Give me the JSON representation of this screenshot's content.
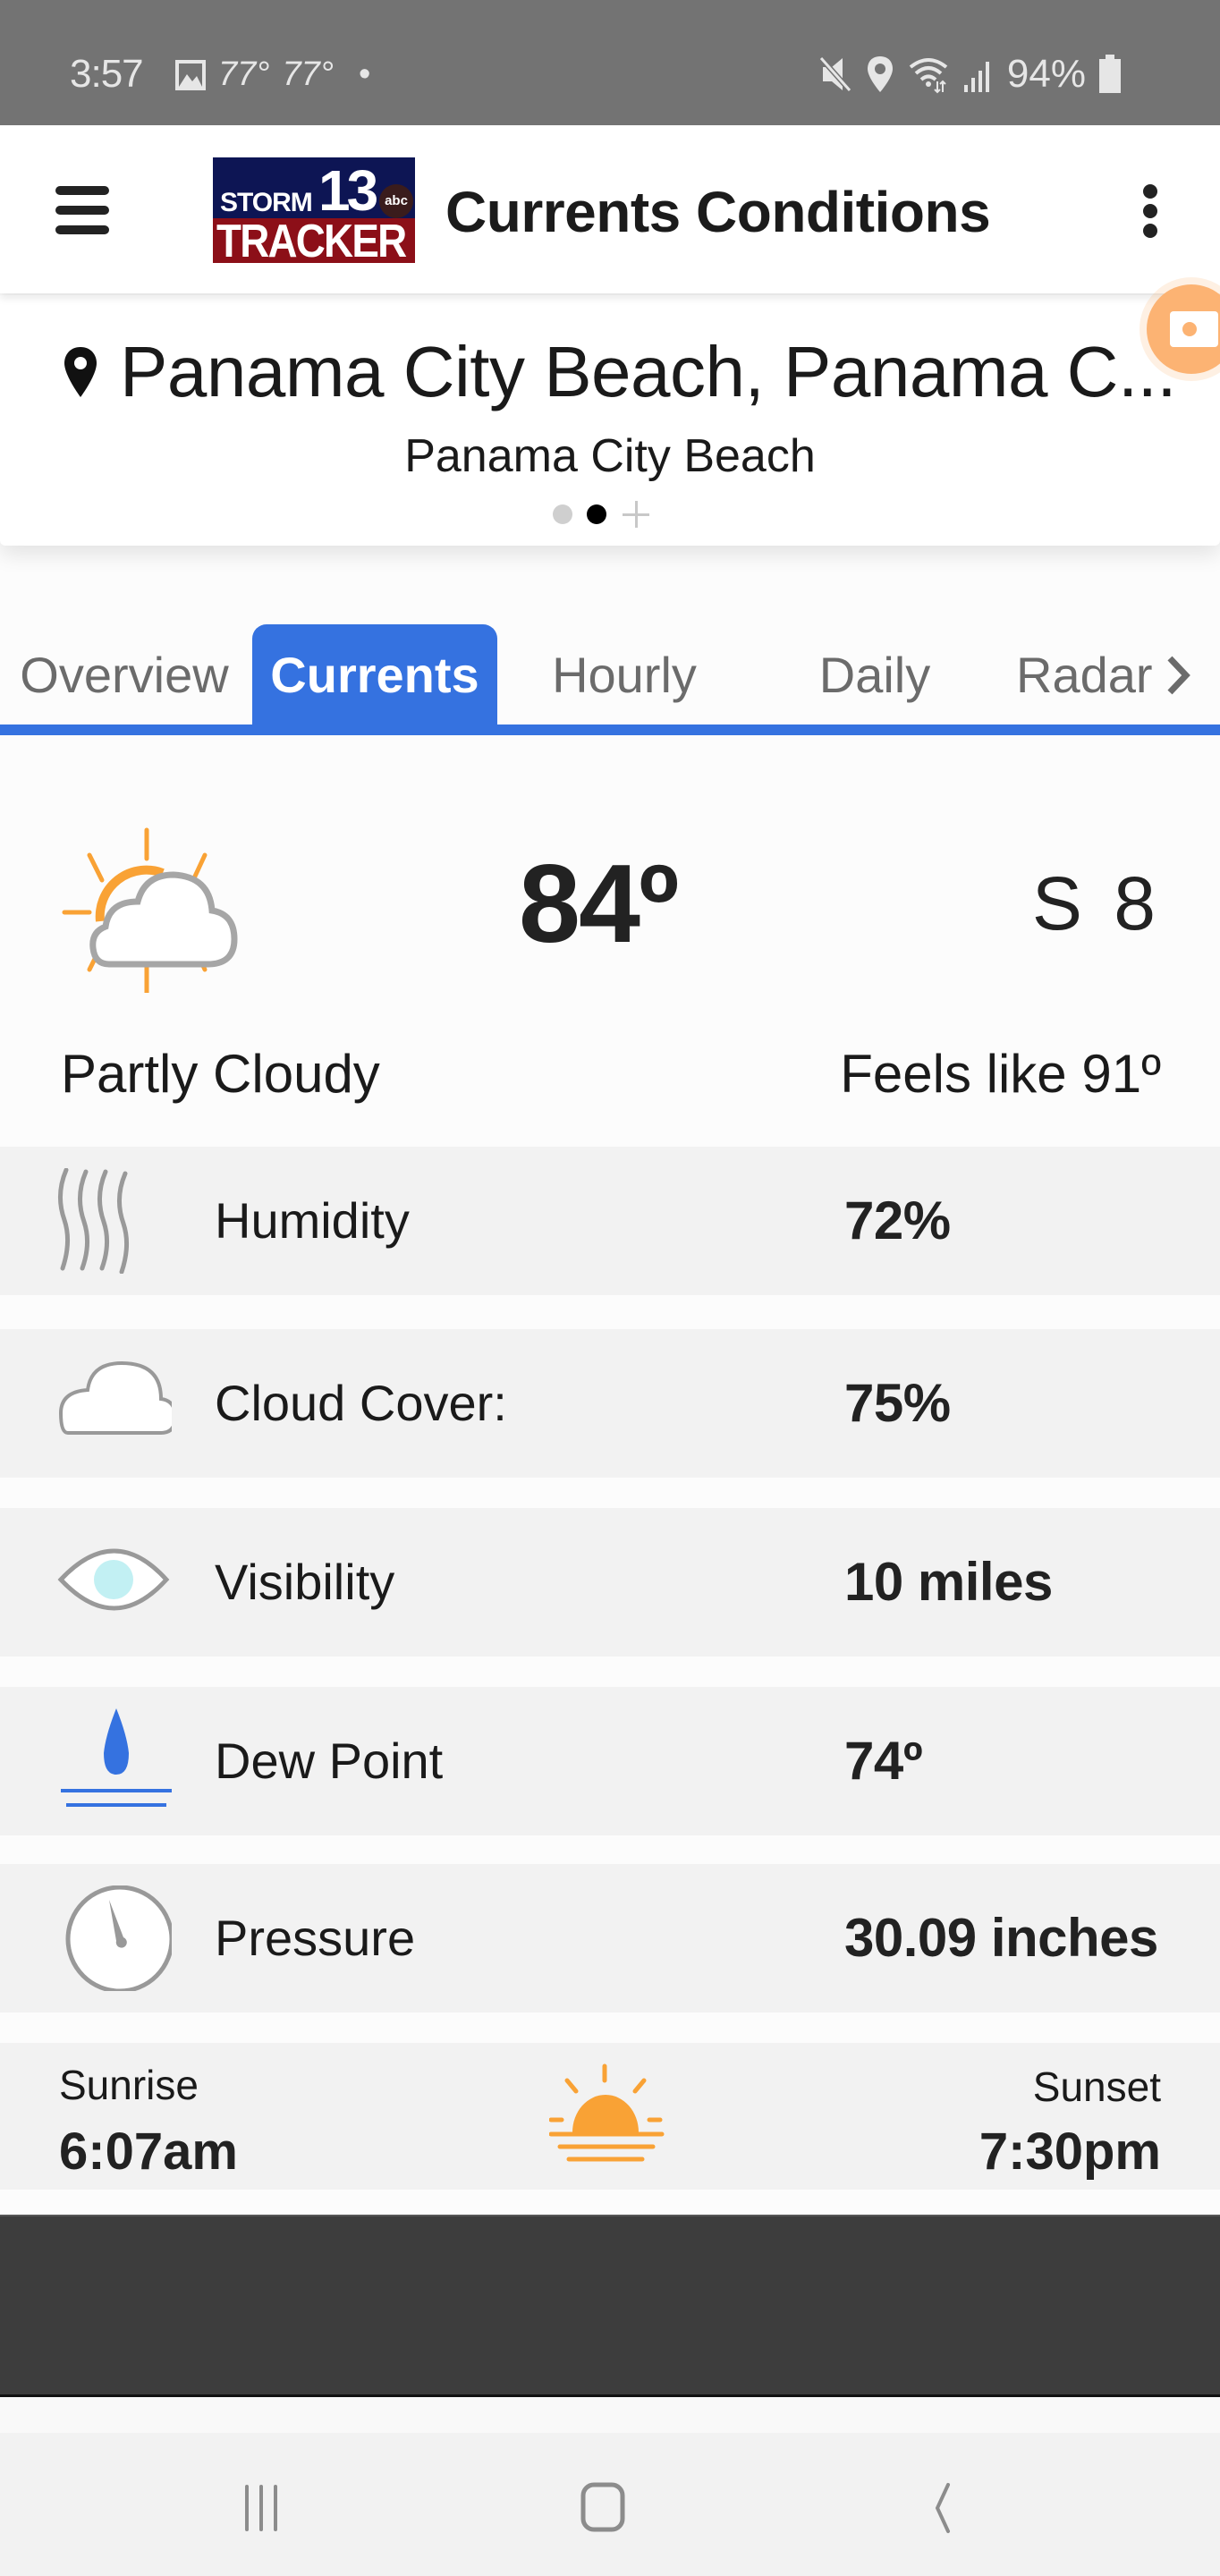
{
  "status_bar": {
    "time": "3:57",
    "left_icons": [
      "gallery-icon"
    ],
    "temps": [
      "77°",
      "77°"
    ],
    "dot": "•",
    "right_icons": [
      "mute-icon",
      "location-icon",
      "wifi-icon",
      "signal-icon"
    ],
    "battery": "94%"
  },
  "app_bar": {
    "logo": {
      "word1": "STORM",
      "number": "13",
      "network": "abc",
      "word2": "TRACKER"
    },
    "title": "Currents Conditions"
  },
  "location": {
    "name": "Panama City Beach, Panama C...",
    "subtitle": "Panama City Beach",
    "pager": {
      "pages": 2,
      "active_index": 1
    }
  },
  "tabs": {
    "items": [
      {
        "label": "Overview",
        "active": false
      },
      {
        "label": "Currents",
        "active": true
      },
      {
        "label": "Hourly",
        "active": false
      },
      {
        "label": "Daily",
        "active": false
      },
      {
        "label": "Radar",
        "active": false
      }
    ]
  },
  "current": {
    "icon": "partly-cloudy-icon",
    "temperature": "84º",
    "wind": "S 8",
    "condition": "Partly Cloudy",
    "feels_like": "Feels like 91º"
  },
  "details": [
    {
      "icon": "humidity-icon",
      "label": "Humidity",
      "value": "72%"
    },
    {
      "icon": "cloud-icon",
      "label": "Cloud Cover:",
      "value": "75%"
    },
    {
      "icon": "eye-icon",
      "label": "Visibility",
      "value": "10 miles"
    },
    {
      "icon": "dew-drop-icon",
      "label": "Dew Point",
      "value": "74º"
    },
    {
      "icon": "gauge-icon",
      "label": "Pressure",
      "value": "30.09 inches"
    }
  ],
  "sun": {
    "sunrise_label": "Sunrise",
    "sunrise": "6:07am",
    "sunset_label": "Sunset",
    "sunset": "7:30pm"
  },
  "colors": {
    "accent": "#3572e0",
    "sun_orange": "#f9a235",
    "status_bar": "#737373",
    "row_bg": "#f2f2f2",
    "ad_band": "#3d3d3d"
  }
}
